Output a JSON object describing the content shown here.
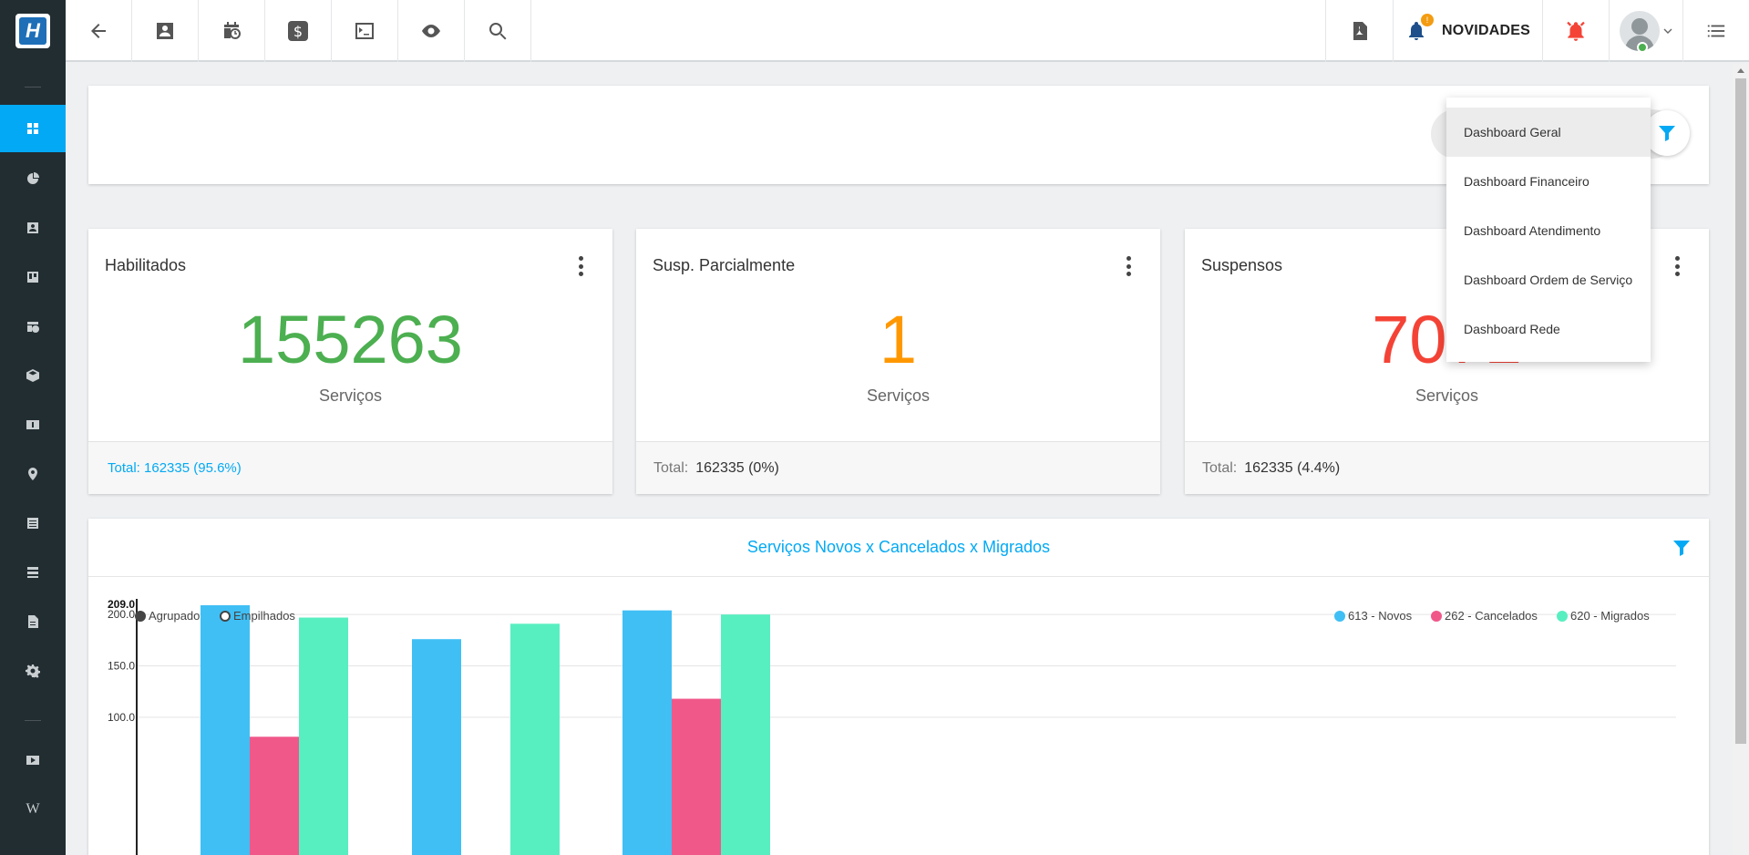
{
  "topbar": {
    "novidades_label": "NOVIDADES",
    "novidades_badge": "!"
  },
  "dropdown": {
    "items": [
      {
        "label": "Dashboard Geral",
        "active": true
      },
      {
        "label": "Dashboard Financeiro"
      },
      {
        "label": "Dashboard Atendimento"
      },
      {
        "label": "Dashboard Ordem de Serviço"
      },
      {
        "label": "Dashboard Rede"
      }
    ]
  },
  "cards": [
    {
      "title": "Habilitados",
      "value": "155263",
      "value_color": "#4caf50",
      "sub": "Serviços",
      "footer": "Total: 162335 (95.6%)"
    },
    {
      "title": "Susp. Parcialmente",
      "value": "1",
      "value_color": "#ff9800",
      "sub": "Serviços",
      "footer_label": "Total:",
      "footer_value": "162335 (0%)"
    },
    {
      "title": "Suspensos",
      "value": "7071",
      "value_color": "#f44336",
      "sub": "Serviços",
      "footer_label": "Total:",
      "footer_value": "162335 (4.4%)"
    }
  ],
  "chart": {
    "title": "Serviços Novos x Cancelados x Migrados",
    "toggle_grouped": "Agrupado",
    "toggle_stacked": "Empilhados"
  },
  "chart_data": {
    "type": "bar",
    "categories": [
      "",
      "",
      ""
    ],
    "series": [
      {
        "name": "613 - Novos",
        "color": "#40bff5",
        "values": [
          209,
          176,
          204
        ]
      },
      {
        "name": "262 - Cancelados",
        "color": "#f0588a",
        "values": [
          81,
          0,
          118
        ]
      },
      {
        "name": "620 - Migrados",
        "color": "#58efc0",
        "values": [
          197,
          191,
          200
        ]
      }
    ],
    "ymax_label": "209.0",
    "yticks": [
      "200.0",
      "150.0",
      "100.0"
    ],
    "grid": true,
    "legend_position": "top-right"
  }
}
